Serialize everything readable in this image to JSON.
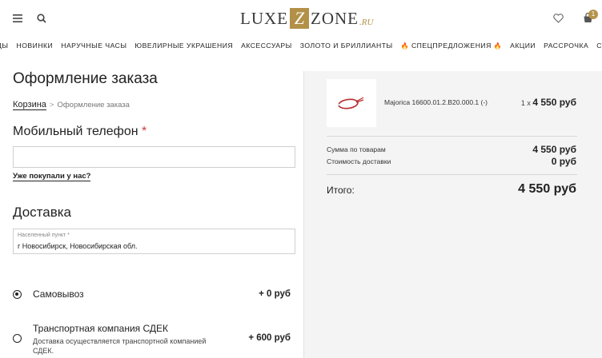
{
  "header": {
    "logo": {
      "left": "LUXE",
      "box_letter": "Z",
      "right": "ZONE",
      "suffix": ".RU"
    },
    "cart_count": "1",
    "icons": [
      "menu-icon",
      "search-icon",
      "heart-icon",
      "cart-icon"
    ]
  },
  "nav": {
    "items": [
      "БРЕНДЫ",
      "НОВИНКИ",
      "НАРУЧНЫЕ ЧАСЫ",
      "ЮВЕЛИРНЫЕ УКРАШЕНИЯ",
      "АКСЕССУАРЫ",
      "ЗОЛОТО И БРИЛЛИАНТЫ",
      "СПЕЦПРЕДЛОЖЕНИЯ",
      "АКЦИИ",
      "РАССРОЧКА",
      "СТАТЬИ"
    ],
    "fire_icon": "🔥"
  },
  "checkout": {
    "title": "Оформление заказа",
    "breadcrumb": {
      "link": "Корзина",
      "separator": ">",
      "current": "Оформление заказа"
    },
    "phone": {
      "label": "Мобильный телефон",
      "required_mark": "*",
      "value": "",
      "already_link": "Уже покупали у нас?"
    },
    "delivery": {
      "title": "Доставка",
      "city_label": "Населенный пункт *",
      "city_value": "г Новосибирск, Новосибирская обл.",
      "options": [
        {
          "title": "Самовывоз",
          "description": "",
          "price": "+ 0 руб",
          "checked": true
        },
        {
          "title": "Транспортная компания СДЕК",
          "description": "Доставка осуществляется транспортной компанией СДЕК.",
          "price": "+ 600 руб",
          "checked": false
        }
      ]
    }
  },
  "summary": {
    "product": {
      "name": "Majorica 16600.01.2.B20.000.1 (-)",
      "qty": "1 x",
      "price": "4 550 руб"
    },
    "goods_label": "Сумма по товарам",
    "goods_value": "4 550 руб",
    "shipping_label": "Стоимость доставки",
    "shipping_value": "0 руб",
    "total_label": "Итого:",
    "total_value": "4 550 руб"
  },
  "colors": {
    "brand_gold": "#b39047",
    "required_red": "#d13a3a",
    "summary_bg": "#f4f4f4"
  }
}
